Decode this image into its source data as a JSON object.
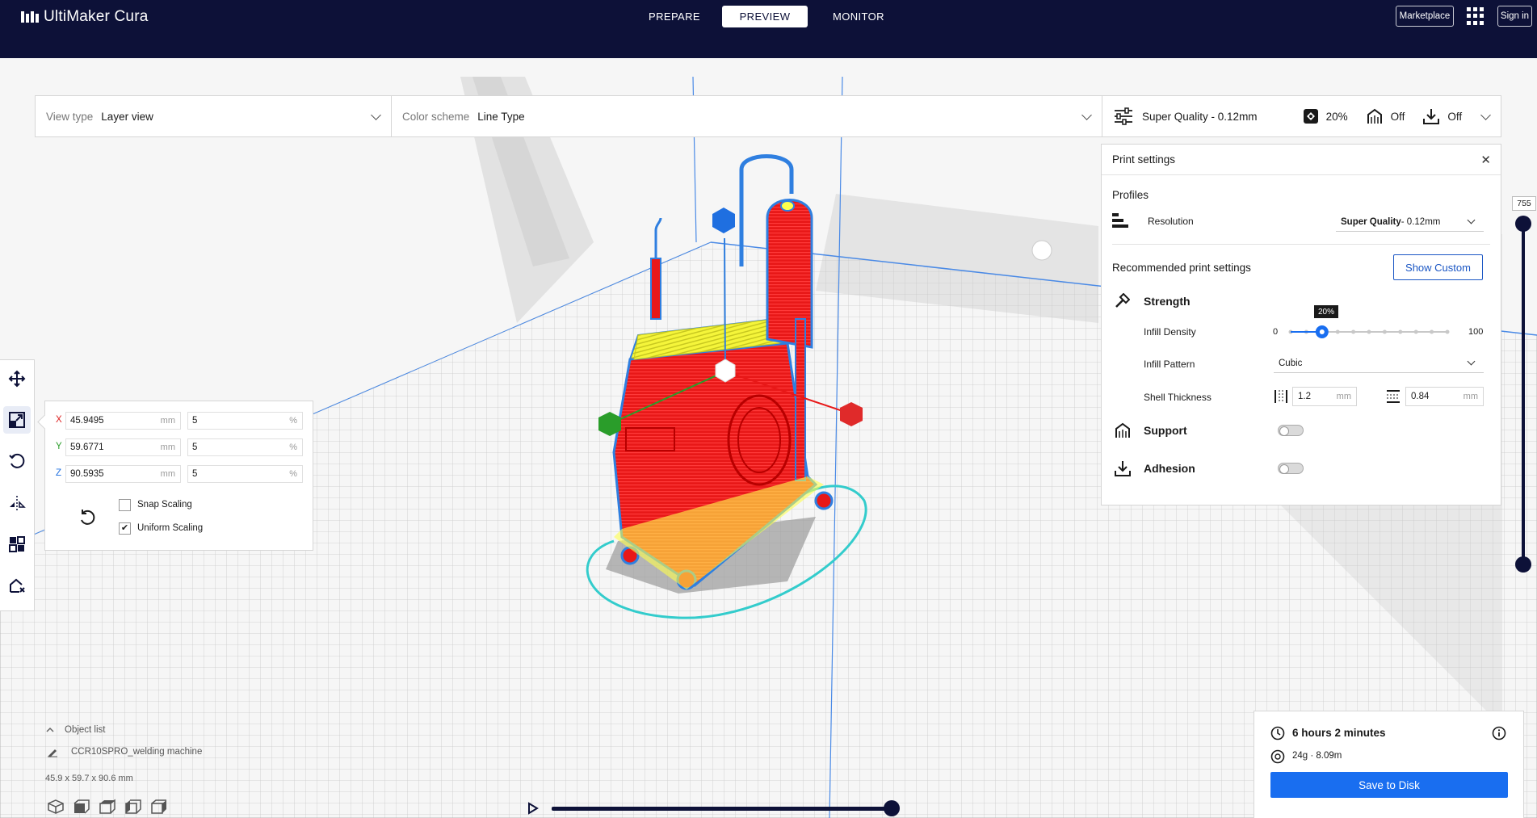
{
  "app": {
    "name": "UltiMaker Cura"
  },
  "stages": {
    "prepare": "PREPARE",
    "preview": "PREVIEW",
    "monitor": "MONITOR",
    "active": "preview"
  },
  "header_right": {
    "marketplace": "Marketplace",
    "sign_in": "Sign in"
  },
  "view_bar": {
    "view_type_label": "View type",
    "view_type_value": "Layer view",
    "color_scheme_label": "Color scheme",
    "color_scheme_value": "Line Type",
    "profile_summary": "Super Quality - 0.12mm",
    "infill_summary": "20%",
    "support_summary": "Off",
    "adhesion_summary": "Off"
  },
  "print_settings": {
    "title": "Print settings",
    "profiles_label": "Profiles",
    "resolution_label": "Resolution",
    "resolution_value_bold": "Super Quality",
    "resolution_value_rest": " - 0.12mm",
    "recommended_label": "Recommended print settings",
    "show_custom": "Show Custom",
    "strength_label": "Strength",
    "infill_density_label": "Infill Density",
    "infill_density_min": "0",
    "infill_density_max": "100",
    "infill_density_value": "20%",
    "infill_density_fraction": 0.2,
    "infill_pattern_label": "Infill Pattern",
    "infill_pattern_value": "Cubic",
    "shell_thickness_label": "Shell Thickness",
    "wall_thickness": "1.2",
    "top_bottom_thickness": "0.84",
    "unit_mm": "mm",
    "support_label": "Support",
    "support_enabled": false,
    "adhesion_label": "Adhesion",
    "adhesion_enabled": false
  },
  "scale_tool": {
    "x_label": "X",
    "y_label": "Y",
    "z_label": "Z",
    "x_mm": "45.9495",
    "y_mm": "59.6771",
    "z_mm": "90.5935",
    "x_pct": "5",
    "y_pct": "5",
    "z_pct": "5",
    "unit_mm": "mm",
    "unit_pct": "%",
    "snap_scaling_label": "Snap Scaling",
    "snap_scaling_checked": false,
    "uniform_scaling_label": "Uniform Scaling",
    "uniform_scaling_checked": true,
    "check_mark": "✔"
  },
  "layer_slider": {
    "max_layer": "755"
  },
  "object_list": {
    "title": "Object list",
    "object_name": "CCR10SPRO_welding machine",
    "dimensions": "45.9 x 59.7 x 90.6 mm"
  },
  "print_estimate": {
    "time": "6 hours 2 minutes",
    "material": "24g · 8.09m",
    "save_button": "Save to Disk"
  },
  "colors": {
    "header_bg": "#0d1138",
    "accent_blue": "#196ef0",
    "model_red": "#ff1a1a",
    "infill_yellow": "#ffff4d",
    "wall_blue": "#2f7fe0",
    "skirt_cyan": "#33cccc"
  },
  "icons": {
    "logo": "ultimaker-logo-icon",
    "apps": "apps-grid-icon",
    "move": "move-icon",
    "scale": "scale-icon",
    "rotate": "rotate-icon",
    "mirror": "mirror-icon",
    "per_model": "per-model-settings-icon",
    "support_blocker": "support-blocker-icon",
    "clock": "clock-icon",
    "info": "info-icon",
    "spool": "spool-icon"
  }
}
